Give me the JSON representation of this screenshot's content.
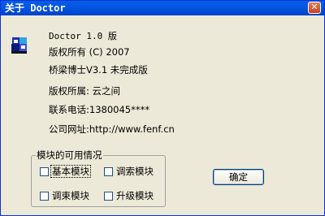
{
  "window": {
    "title": "关于 Doctor",
    "close_glyph": "✕"
  },
  "info": {
    "line1": "Doctor 1.0 版",
    "line2": "版权所有 (C) 2007",
    "line3": "桥梁博士V3.1 未完成版",
    "line4": "版权所属: 云之间",
    "line5": "联系电话:1380045****",
    "line6": "公司网址:http://www.fenf.cn"
  },
  "modules": {
    "legend": "模块的可用情况",
    "items": [
      {
        "label": "基本模块",
        "checked": false
      },
      {
        "label": "调索模块",
        "checked": false
      },
      {
        "label": "调束模块",
        "checked": false
      },
      {
        "label": "升级模块",
        "checked": false
      }
    ]
  },
  "ok_label": "确定",
  "icon": "doctor-app-icon"
}
